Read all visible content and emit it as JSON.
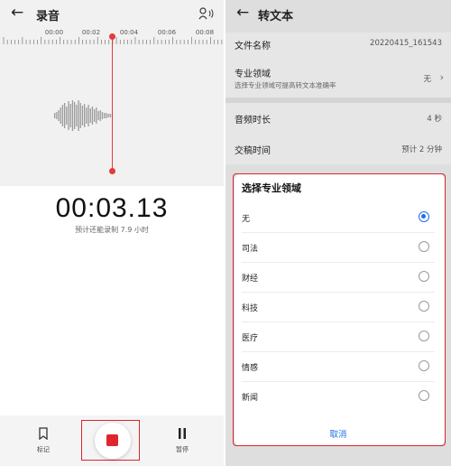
{
  "left": {
    "title": "录音",
    "timeline_labels": [
      "00:00",
      "00:02",
      "00:04",
      "00:06",
      "00:08"
    ],
    "timer": "00:03.13",
    "remaining": "预计还能录制 7.9 小时",
    "mark_label": "标记",
    "pause_label": "暂停",
    "icons": [
      "back-arrow-icon",
      "mic-settings-icon",
      "bookmark-icon",
      "stop-icon",
      "pause-icon"
    ]
  },
  "right": {
    "title": "转文本",
    "file_name_label": "文件名称",
    "file_name_value": "20220415_161543",
    "field_label": "专业领域",
    "field_sub": "选择专业领域可提高转文本准确率",
    "field_value": "无",
    "duration_label": "音频时长",
    "duration_value": "4 秒",
    "delivery_label": "交稿时间",
    "delivery_value": "预计 2 分钟",
    "sheet": {
      "title": "选择专业领域",
      "options": [
        {
          "label": "无",
          "selected": true
        },
        {
          "label": "司法",
          "selected": false
        },
        {
          "label": "财经",
          "selected": false
        },
        {
          "label": "科技",
          "selected": false
        },
        {
          "label": "医疗",
          "selected": false
        },
        {
          "label": "情感",
          "selected": false
        },
        {
          "label": "新闻",
          "selected": false
        }
      ],
      "cancel": "取消"
    }
  },
  "colors": {
    "accent_blue": "#1e6fe6",
    "record_red": "#e0262c",
    "highlight_frame": "#d8262f"
  }
}
